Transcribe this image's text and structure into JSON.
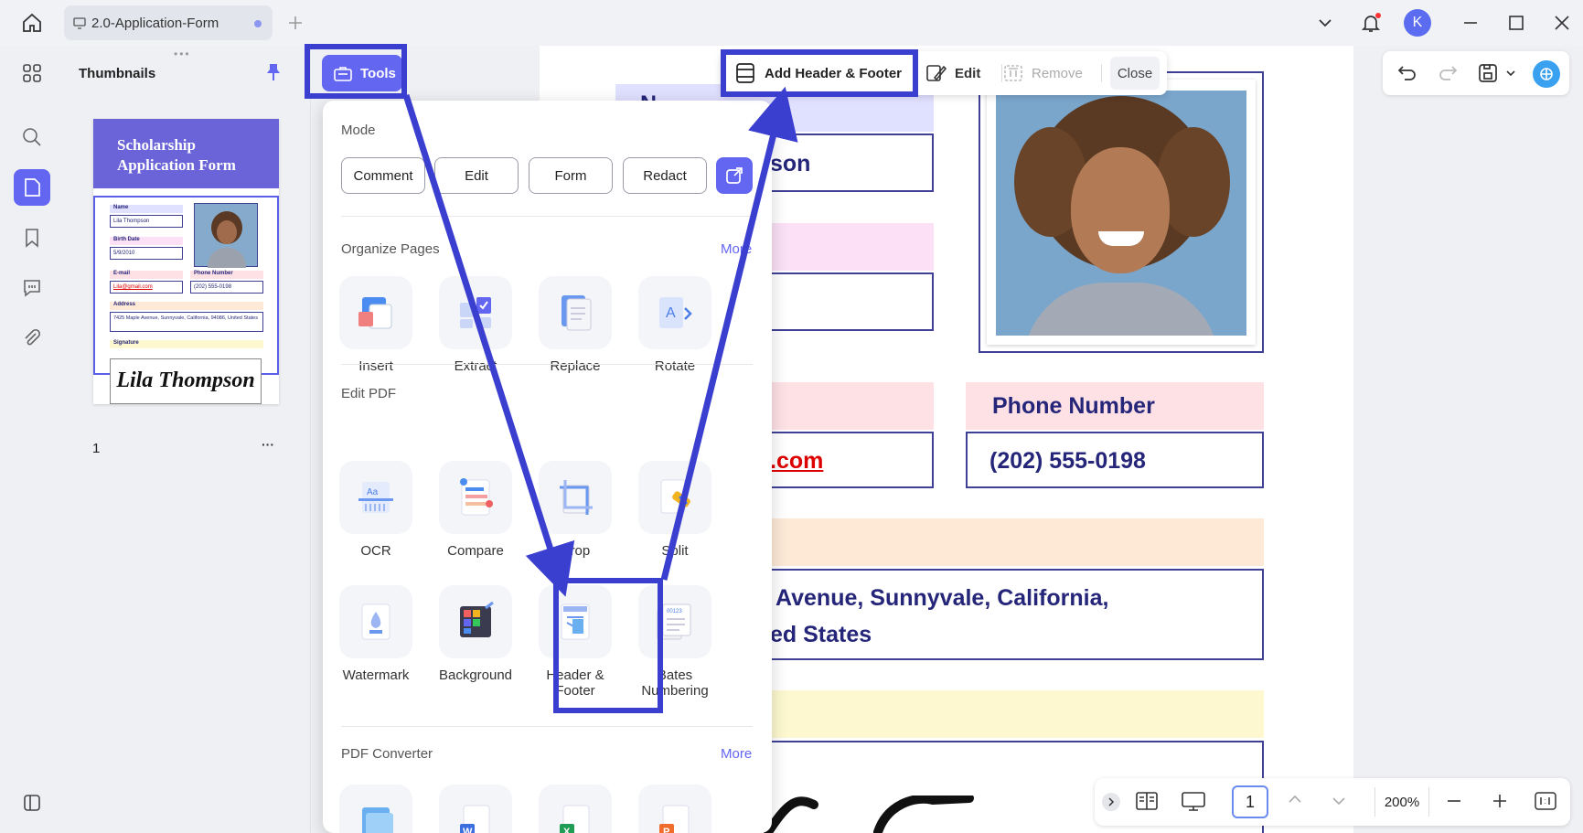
{
  "titlebar": {
    "tab_title": "2.0-Application-Form",
    "avatar_letter": "K"
  },
  "thumbnails": {
    "title": "Thumbnails",
    "page_number": "1",
    "more": "···",
    "mini": {
      "banner": "Scholarship Application Form",
      "name_label": "Name",
      "name_value": "Lila Thompson",
      "birth_label": "Birth Date",
      "birth_value": "5/9/2010",
      "email_label": "E-mail",
      "email_value": "Lila@gmail.com",
      "phone_label": "Phone Number",
      "phone_value": "(202) 555-0198",
      "address_label": "Address",
      "address_value": "7425 Maple Avenue, Sunnyvale, California, 94086, United States",
      "signature_label": "Signature",
      "signature_value": "Lila Thompson"
    }
  },
  "tools_button": {
    "label": "Tools"
  },
  "tools_panel": {
    "mode_title": "Mode",
    "modes": [
      "Comment",
      "Edit",
      "Form",
      "Redact"
    ],
    "organize_title": "Organize Pages",
    "organize_more": "More",
    "organize_items": [
      "Insert",
      "Extract",
      "Replace",
      "Rotate"
    ],
    "edit_title": "Edit PDF",
    "edit_items": [
      "OCR",
      "Compare",
      "Crop",
      "Split",
      "Watermark",
      "Background",
      "Header & Footer",
      "Bates Numbering"
    ],
    "converter_title": "PDF Converter",
    "converter_more": "More"
  },
  "hf_toolbar": {
    "add_label": "Add Header & Footer",
    "edit_label": "Edit",
    "remove_label": "Remove",
    "close_label": "Close"
  },
  "document": {
    "name_value_partial": "son",
    "email_value_partial": ".com",
    "phone_label": "Phone Number",
    "phone_value": "(202) 555-0198",
    "address_line1": "Avenue, Sunnyvale, California,",
    "address_line2": "ed States",
    "name_label_partial": "N"
  },
  "bottom_bar": {
    "page_input": "1",
    "zoom": "200%"
  },
  "colors": {
    "accent": "#6366f1",
    "highlight": "#3b3fcf",
    "doc_text": "#25257a"
  }
}
